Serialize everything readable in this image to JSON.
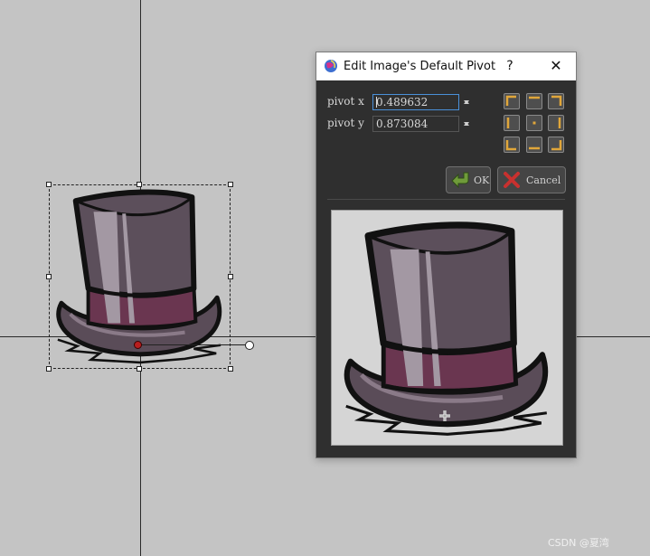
{
  "dialog": {
    "title": "Edit Image's Default Pivot",
    "help_label": "?",
    "close_label": "✕",
    "pivot_x_label": "pivot x",
    "pivot_y_label": "pivot y",
    "pivot_x_value": "0.489632",
    "pivot_y_value": "0.873084",
    "ok_label": "OK",
    "cancel_label": "Cancel",
    "anchor_presets": [
      "top-left",
      "top-center",
      "top-right",
      "middle-left",
      "center",
      "middle-right",
      "bottom-left",
      "bottom-center",
      "bottom-right"
    ]
  },
  "colors": {
    "canvas_bg": "#c4c4c4",
    "dialog_bg": "#2f2f2f",
    "field_focus": "#4a90d9",
    "pivot_marker": "#b81e1e",
    "anchor_accent": "#e0a63a",
    "ok_arrow": "#6f9b3a",
    "cancel_x": "#c8312f"
  },
  "watermark": "CSDN @夏湾"
}
